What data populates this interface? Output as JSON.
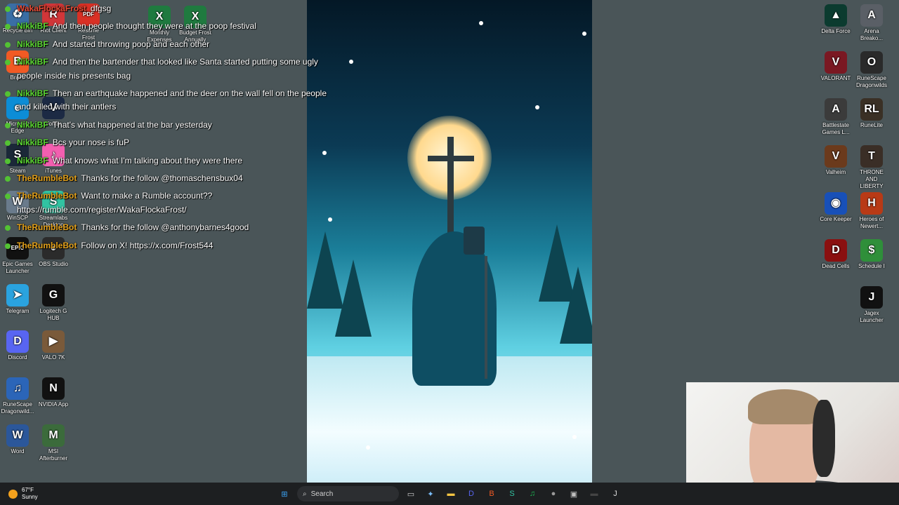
{
  "chat": {
    "messages": [
      {
        "user": "WakaFlockaFrost",
        "text": "dfgsg",
        "kind": "waka"
      },
      {
        "user": "NikkiBF",
        "text": "And then people thought they were at the poop festival",
        "kind": "nikki"
      },
      {
        "user": "NikkiBF",
        "text": "And started throwing poop and each other",
        "kind": "nikki"
      },
      {
        "user": "NikkiBF",
        "text": "And then the bartender that looked like Santa started putting some ugly",
        "cont": "people inside his presents bag",
        "kind": "nikki"
      },
      {
        "user": "NikkiBF",
        "text": "Then an earthquake happened and the deer on the wall fell on the people",
        "cont": "and killed with their antlers",
        "kind": "nikki"
      },
      {
        "user": "NikkiBF",
        "text": "That's what happened at the bar yesterday",
        "kind": "nikki"
      },
      {
        "user": "NikkiBF",
        "text": "Bcs your nose is fuP",
        "kind": "nikki"
      },
      {
        "user": "NikkiBF",
        "text": "What knows what I'm talking about they were there",
        "kind": "nikki"
      },
      {
        "user": "TheRumbleBot",
        "text": "Thanks for the follow @thomaschensbux04",
        "kind": "bot"
      },
      {
        "user": "TheRumbleBot",
        "text": "Want to make a Rumble account??",
        "cont": "https://rumble.com/register/WakaFlockaFrost/",
        "kind": "bot"
      },
      {
        "user": "TheRumbleBot",
        "text": "Thanks for the follow @anthonybarnes4good",
        "kind": "bot"
      },
      {
        "user": "TheRumbleBot",
        "text": "Follow on X! https://x.com/Frost544",
        "kind": "bot"
      }
    ]
  },
  "desktop_left": [
    {
      "label": "Recycle Bin",
      "icon": "recycle-bin-icon",
      "color": "#3a6ea5",
      "glyph": "♻"
    },
    {
      "label": "Riot Client",
      "icon": "riot-client-icon",
      "color": "#d13639",
      "glyph": "R"
    },
    {
      "label": "Resume Frost",
      "icon": "pdf-icon",
      "color": "#d93025",
      "glyph": "PDF"
    },
    {
      "label": "Monthly Expenses",
      "icon": "excel-icon",
      "color": "#1f7a3f",
      "glyph": "X"
    },
    {
      "label": "Budget Frost Annually",
      "icon": "excel-icon",
      "color": "#1f7a3f",
      "glyph": "X"
    },
    {
      "label": "Brave",
      "icon": "brave-icon",
      "color": "#f15a24",
      "glyph": "B"
    },
    {
      "label": "Microsoft Edge",
      "icon": "edge-icon",
      "color": "#0c8dd6",
      "glyph": "e"
    },
    {
      "label": "Vortex",
      "icon": "vortex-icon",
      "color": "#1c2a44",
      "glyph": "V"
    },
    {
      "label": "Steam",
      "icon": "steam-icon",
      "color": "#1b2838",
      "glyph": "S"
    },
    {
      "label": "iTunes",
      "icon": "itunes-icon",
      "color": "#f35fb0",
      "glyph": "♪"
    },
    {
      "label": "WinSCP",
      "icon": "winscp-icon",
      "color": "#6a7b8c",
      "glyph": "W"
    },
    {
      "label": "Streamlabs Desktop",
      "icon": "streamlabs-icon",
      "color": "#31c3a2",
      "glyph": "S"
    },
    {
      "label": "Epic Games Launcher",
      "icon": "epic-games-icon",
      "color": "#111",
      "glyph": "EPIC"
    },
    {
      "label": "OBS Studio",
      "icon": "obs-icon",
      "color": "#2b2b2b",
      "glyph": "●"
    },
    {
      "label": "Telegram",
      "icon": "telegram-icon",
      "color": "#2aa3df",
      "glyph": "➤"
    },
    {
      "label": "Logitech G HUB",
      "icon": "logitech-icon",
      "color": "#111",
      "glyph": "G"
    },
    {
      "label": "Discord",
      "icon": "discord-icon",
      "color": "#5865f2",
      "glyph": "D"
    },
    {
      "label": "VALO 7K",
      "icon": "video-file-icon",
      "color": "#7a5a3a",
      "glyph": "▶"
    },
    {
      "label": "RuneScape Dragonwild...",
      "icon": "runescape-icon",
      "color": "#2b65b8",
      "glyph": "♫"
    },
    {
      "label": "NVIDIA App",
      "icon": "nvidia-icon",
      "color": "#111",
      "glyph": "N"
    },
    {
      "label": "Word",
      "icon": "word-icon",
      "color": "#2b579a",
      "glyph": "W"
    },
    {
      "label": "MSI Afterburner",
      "icon": "msi-afterburner-icon",
      "color": "#3b6b3b",
      "glyph": "M"
    }
  ],
  "desktop_right": [
    {
      "label": "Delta Force",
      "icon": "delta-force-icon",
      "color": "#0b3b2f",
      "glyph": "▲"
    },
    {
      "label": "Arena Breako...",
      "icon": "arena-breakout-icon",
      "color": "#5a5f66",
      "glyph": "A"
    },
    {
      "label": "VALORANT",
      "icon": "valorant-icon",
      "color": "#7a1822",
      "glyph": "V"
    },
    {
      "label": "RuneScape Dragonwilds",
      "icon": "runescape-dragonwilds-icon",
      "color": "#2a2a2a",
      "glyph": "O"
    },
    {
      "label": "Battlestate Games L...",
      "icon": "battlestate-icon",
      "color": "#3b3b3b",
      "glyph": "A"
    },
    {
      "label": "RuneLite",
      "icon": "runelite-icon",
      "color": "#3a3025",
      "glyph": "RL"
    },
    {
      "label": "Valheim",
      "icon": "valheim-icon",
      "color": "#6b3a1c",
      "glyph": "V"
    },
    {
      "label": "THRONE AND LIBERTY",
      "icon": "throne-liberty-icon",
      "color": "#3a2e26",
      "glyph": "T"
    },
    {
      "label": "Core Keeper",
      "icon": "core-keeper-icon",
      "color": "#1850b8",
      "glyph": "◉"
    },
    {
      "label": "Heroes of Newert...",
      "icon": "heroes-newerth-icon",
      "color": "#b83a16",
      "glyph": "H"
    },
    {
      "label": "Dead Cells",
      "icon": "dead-cells-icon",
      "color": "#8a1010",
      "glyph": "D"
    },
    {
      "label": "Schedule I",
      "icon": "schedule-i-icon",
      "color": "#2f8f3a",
      "glyph": "$"
    },
    {
      "label": "Jagex Launcher",
      "icon": "jagex-icon",
      "color": "#111",
      "glyph": "J"
    }
  ],
  "taskbar": {
    "weather_temp": "67°F",
    "weather_desc": "Sunny",
    "search_placeholder": "Search",
    "apps": [
      {
        "name": "start-button",
        "glyph": "⊞",
        "color": "#3ba3f5"
      },
      {
        "name": "task-view-button",
        "glyph": "▭",
        "color": "#d0d0d0"
      },
      {
        "name": "copilot-button",
        "glyph": "✦",
        "color": "#7cc0ff"
      },
      {
        "name": "file-explorer-button",
        "glyph": "▬",
        "color": "#f5c542"
      },
      {
        "name": "discord-taskbar-button",
        "glyph": "D",
        "color": "#5865f2"
      },
      {
        "name": "brave-taskbar-button",
        "glyph": "B",
        "color": "#f15a24"
      },
      {
        "name": "streamlabs-taskbar-button",
        "glyph": "S",
        "color": "#31c3a2"
      },
      {
        "name": "spotify-taskbar-button",
        "glyph": "♫",
        "color": "#1db954"
      },
      {
        "name": "obs-taskbar-button",
        "glyph": "●",
        "color": "#9a9a9a"
      },
      {
        "name": "app-taskbar-button",
        "glyph": "▣",
        "color": "#c0c0c0"
      },
      {
        "name": "terminal-taskbar-button",
        "glyph": "▬",
        "color": "#444"
      },
      {
        "name": "jagex-taskbar-button",
        "glyph": "J",
        "color": "#ddd"
      }
    ]
  }
}
